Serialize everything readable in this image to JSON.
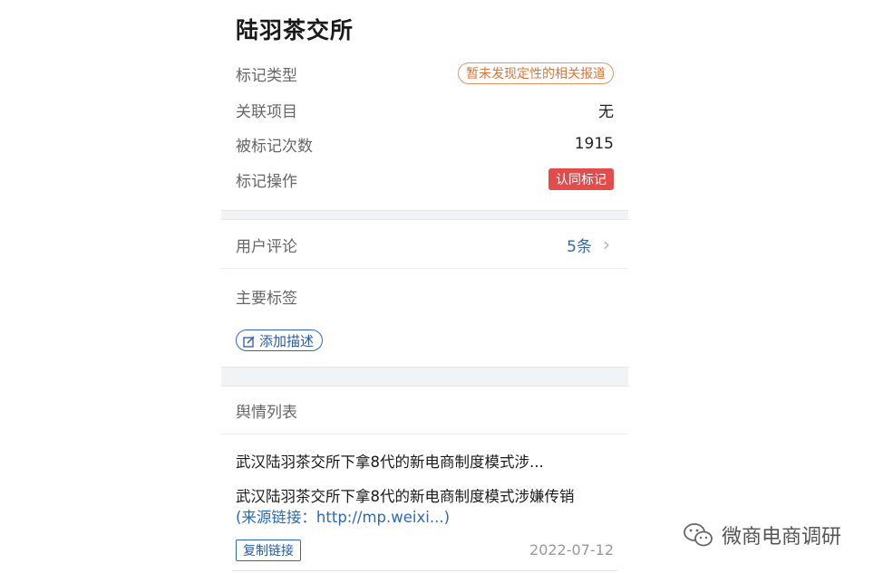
{
  "header": {
    "title": "陆羽茶交所"
  },
  "info": {
    "mark_type_label": "标记类型",
    "mark_type_value": "暂未发现定性的相关报道",
    "related_label": "关联项目",
    "related_value": "无",
    "mark_count_label": "被标记次数",
    "mark_count_value": "1915",
    "mark_action_label": "标记操作",
    "mark_action_button": "认同标记"
  },
  "comments": {
    "label": "用户评论",
    "count": "5条"
  },
  "tags": {
    "title": "主要标签",
    "add_button": "添加描述"
  },
  "opinion": {
    "title": "舆情列表",
    "items": [
      {
        "headline": "武汉陆羽茶交所下拿8代的新电商制度模式涉...",
        "body": "武汉陆羽茶交所下拿8代的新电商制度模式涉嫌传销",
        "link": "(来源链接：http://mp.weixi...)",
        "copy_button": "复制链接",
        "date": "2022-07-12"
      }
    ]
  },
  "watermark": {
    "text": "微商电商调研"
  },
  "colors": {
    "accent_blue": "#2a6ab8",
    "tag_orange": "#e0743a",
    "tag_red": "#e24c4c"
  }
}
